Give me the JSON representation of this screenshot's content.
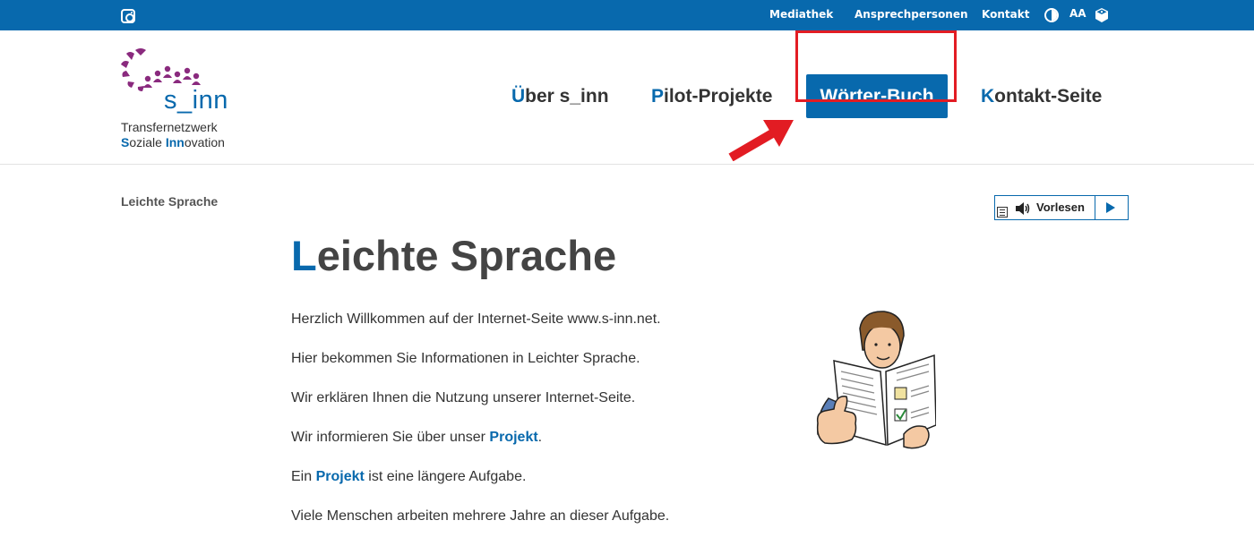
{
  "topbar": {
    "links": [
      "Mediathek",
      "Ansprechpersonen",
      "Kontakt"
    ],
    "icons": [
      "instagram-icon",
      "contrast-icon",
      "font-size-icon",
      "accessibility-icon"
    ],
    "font_size_label": "AA",
    "bg_color": "#0869ad"
  },
  "logo": {
    "word": "s_inn",
    "sub1": "Transfernetzwerk",
    "sub2_a": "S",
    "sub2_b": "oziale ",
    "sub2_c": "Inn",
    "sub2_d": "ovation"
  },
  "nav": {
    "items": [
      {
        "first": "Ü",
        "rest": "ber s_inn"
      },
      {
        "first": "P",
        "rest": "ilot-Projekte"
      },
      {
        "label": "Wörter-Buch",
        "active": true
      },
      {
        "first": "K",
        "rest": "ontakt-Seite"
      }
    ]
  },
  "breadcrumb": "Leichte Sprache",
  "player": {
    "label": "Vorlesen"
  },
  "main": {
    "title_first": "L",
    "title_rest": "eichte Sprache",
    "paragraphs": [
      "Herzlich Willkommen auf der Internet-Seite www.s-inn.net.",
      "Hier bekommen Sie Informationen in Leichter Sprache.",
      "Wir erklären Ihnen die Nutzung unserer Internet-Seite."
    ],
    "p4_before": "Wir informieren Sie über unser ",
    "p4_link": "Projekt",
    "p4_after": ".",
    "p5_before": "Ein ",
    "p5_link": "Projekt",
    "p5_after": " ist eine längere Aufgabe.",
    "p6": "Viele Menschen arbeiten mehrere Jahre an dieser Aufgabe."
  },
  "colors": {
    "accent": "#0869ad",
    "logo_purple": "#8a2a7e",
    "highlight": "#e21c23"
  }
}
